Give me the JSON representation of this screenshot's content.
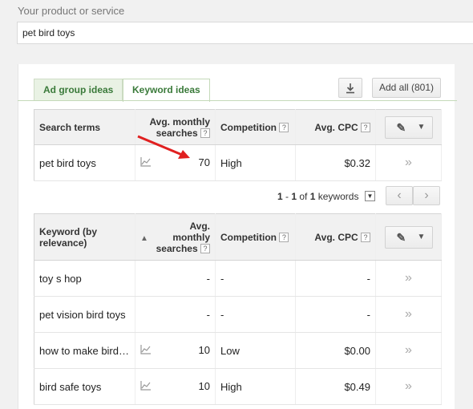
{
  "product": {
    "label": "Your product or service",
    "value": "pet bird toys"
  },
  "tabs": [
    {
      "label": "Ad group ideas"
    },
    {
      "label": "Keyword ideas"
    }
  ],
  "toolbar": {
    "download_icon": "download-icon",
    "add_all_label": "Add all (801)"
  },
  "search_table": {
    "headers": {
      "col1": "Search terms",
      "col2a": "Avg. monthly",
      "col2b": "searches",
      "col3": "Competition",
      "col4": "Avg. CPC"
    },
    "rows": [
      {
        "term": "pet bird toys",
        "searches": "70",
        "competition": "High",
        "cpc": "$0.32"
      }
    ]
  },
  "pager": {
    "start": "1",
    "sep": " - ",
    "end": "1",
    "of": " of ",
    "total": "1",
    "suffix": " keywords"
  },
  "keyword_table": {
    "headers": {
      "col1a": "Keyword (by",
      "col1b": "relevance)",
      "col2a": "Avg.",
      "col2b": "monthly",
      "col2c": "searches",
      "col3": "Competition",
      "col4": "Avg. CPC"
    },
    "rows": [
      {
        "keyword": "toy s hop",
        "searches": "-",
        "competition": "-",
        "cpc": "-",
        "trend": false
      },
      {
        "keyword": "pet vision bird toys",
        "searches": "-",
        "competition": "-",
        "cpc": "-",
        "trend": false
      },
      {
        "keyword": "how to make bird…",
        "searches": "10",
        "competition": "Low",
        "cpc": "$0.00",
        "trend": true
      },
      {
        "keyword": "bird safe toys",
        "searches": "10",
        "competition": "High",
        "cpc": "$0.49",
        "trend": true
      }
    ]
  },
  "colors": {
    "tab_active_text": "#3a7a3a",
    "annotation_arrow": "#e02020"
  }
}
